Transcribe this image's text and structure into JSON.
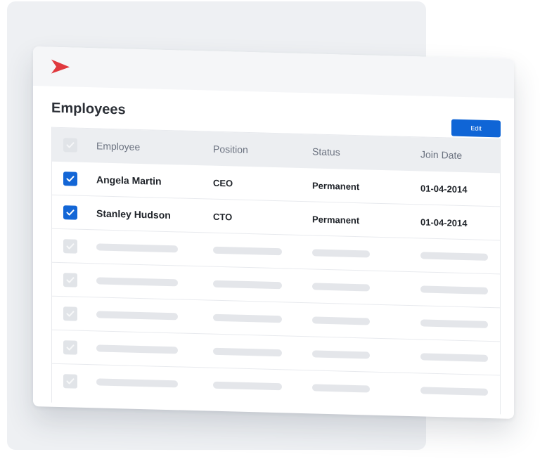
{
  "page": {
    "title": "Employees",
    "edit_label": "Edit",
    "logo_icon": "chevron-right-icon",
    "accent_color": "#e0393e",
    "primary_color": "#0f65d6"
  },
  "table": {
    "columns": [
      "Employee",
      "Position",
      "Status",
      "Join Date"
    ],
    "rows": [
      {
        "employee": "Angela Martin",
        "position": "CEO",
        "status": "Permanent",
        "join_date": "01-04-2014",
        "checked": true
      },
      {
        "employee": "Stanley Hudson",
        "position": "CTO",
        "status": "Permanent",
        "join_date": "01-04-2014",
        "checked": true
      }
    ],
    "placeholder_rows": 5
  }
}
